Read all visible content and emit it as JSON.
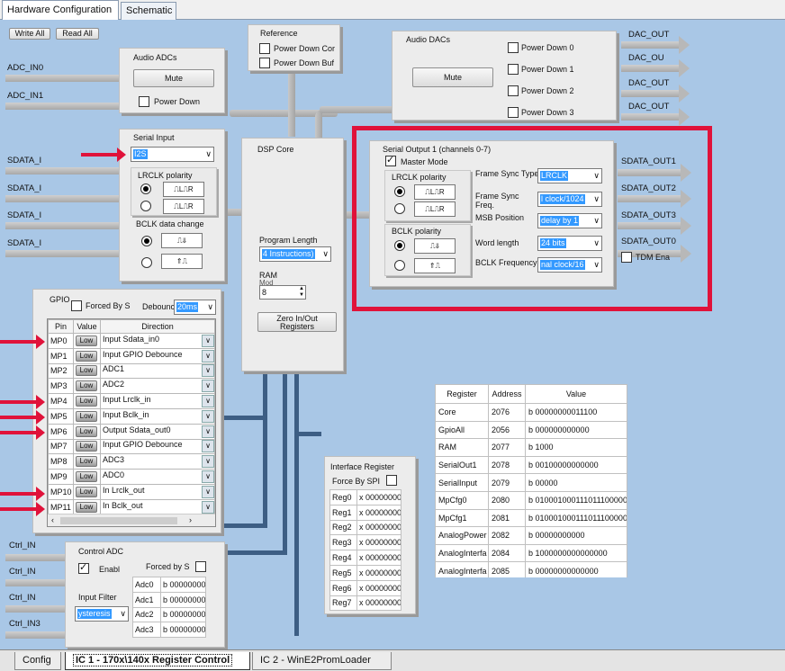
{
  "top_tabs": [
    "Hardware Configuration",
    "Schematic"
  ],
  "bottom_tabs": [
    "Config",
    "IC 1 - 170x\\140x Register Control",
    "IC 2 - WinE2PromLoader"
  ],
  "toolbar": {
    "write_all": "Write All",
    "read_all": "Read All"
  },
  "left_signals": [
    "ADC_IN0",
    "ADC_IN1",
    "SDATA_I",
    "SDATA_I",
    "SDATA_I",
    "SDATA_I"
  ],
  "ctrl_signals": [
    "Ctrl_IN",
    "Ctrl_IN",
    "Ctrl_IN",
    "Ctrl_IN3"
  ],
  "audio_adcs": {
    "title": "Audio ADCs",
    "mute": "Mute",
    "power_down": "Power Down"
  },
  "reference": {
    "title": "Reference",
    "power_down_cor": "Power Down Cor",
    "power_down_buf": "Power Down Buf"
  },
  "audio_dacs": {
    "title": "Audio DACs",
    "mute": "Mute",
    "power_down": [
      "Power Down 0",
      "Power Down 1",
      "Power Down 2",
      "Power Down 3"
    ]
  },
  "dac_outputs": [
    "DAC_OUT",
    "DAC_OU",
    "DAC_OUT",
    "DAC_OUT"
  ],
  "serial_input": {
    "title": "Serial Input",
    "format": "I2S",
    "lrclk_polarity": "LRCLK polarity",
    "bclk_data_change": "BCLK data change"
  },
  "dsp_core": {
    "title": "DSP Core",
    "program_length_label": "Program Length",
    "program_length_value": "4 Instructions)",
    "ram_label": "RAM",
    "ram_sub": "Mod",
    "ram_value": "8",
    "zero_button": "Zero In/Out Registers"
  },
  "serial_output": {
    "title": "Serial Output 1 (channels 0-7)",
    "master_mode": "Master Mode",
    "lrclk_polarity": "LRCLK polarity",
    "bclk_polarity": "BCLK polarity",
    "frame_sync_type_label": "Frame Sync Type",
    "frame_sync_type_value": "LRCLK",
    "frame_sync_freq_label": "Frame Sync Freq.",
    "frame_sync_freq_value": "l clock/1024",
    "msb_position_label": "MSB Position",
    "msb_position_value": "delay by 1",
    "word_length_label": "Word length",
    "word_length_value": "24 bits",
    "bclk_freq_label": "BCLK Frequency",
    "bclk_freq_value": "nal clock/16"
  },
  "sdata_outputs": [
    "SDATA_OUT1",
    "SDATA_OUT2",
    "SDATA_OUT3",
    "SDATA_OUT0"
  ],
  "tdm_ena": "TDM Ena",
  "gpio": {
    "title": "GPIO",
    "forced_by": "Forced By S",
    "debounce_label": "Debounc",
    "debounce_value": "20ms",
    "headers": [
      "Pin",
      "Value",
      "Direction"
    ],
    "rows": [
      {
        "pin": "MP0",
        "value": "Low",
        "dir": "Input  Sdata_in0"
      },
      {
        "pin": "MP1",
        "value": "Low",
        "dir": "Input  GPIO Debounce"
      },
      {
        "pin": "MP2",
        "value": "Low",
        "dir": "ADC1"
      },
      {
        "pin": "MP3",
        "value": "Low",
        "dir": "ADC2"
      },
      {
        "pin": "MP4",
        "value": "Low",
        "dir": "Input  Lrclk_in"
      },
      {
        "pin": "MP5",
        "value": "Low",
        "dir": "Input  Bclk_in"
      },
      {
        "pin": "MP6",
        "value": "Low",
        "dir": "Output Sdata_out0"
      },
      {
        "pin": "MP7",
        "value": "Low",
        "dir": "Input  GPIO Debounce"
      },
      {
        "pin": "MP8",
        "value": "Low",
        "dir": "ADC3"
      },
      {
        "pin": "MP9",
        "value": "Low",
        "dir": "ADC0"
      },
      {
        "pin": "MP10",
        "value": "Low",
        "dir": "In Lrclk_out"
      },
      {
        "pin": "MP11",
        "value": "Low",
        "dir": "In Bclk_out"
      }
    ]
  },
  "control_adc": {
    "title": "Control ADC",
    "enable": "Enabl",
    "forced_by": "Forced by S",
    "input_filter": "Input Filter",
    "filter_value": "ysteresis",
    "rows": [
      {
        "name": "Adc0",
        "val": "b 00000000"
      },
      {
        "name": "Adc1",
        "val": "b 00000000"
      },
      {
        "name": "Adc2",
        "val": "b 00000000"
      },
      {
        "name": "Adc3",
        "val": "b 00000000"
      }
    ]
  },
  "interface_register": {
    "title": "Interface Register",
    "force_by_spi": "Force By SPI",
    "rows": [
      {
        "name": "Reg0",
        "val": "x 00000000"
      },
      {
        "name": "Reg1",
        "val": "x 00000000"
      },
      {
        "name": "Reg2",
        "val": "x 00000000"
      },
      {
        "name": "Reg3",
        "val": "x 00000000"
      },
      {
        "name": "Reg4",
        "val": "x 00000000"
      },
      {
        "name": "Reg5",
        "val": "x 00000000"
      },
      {
        "name": "Reg6",
        "val": "x 00000000"
      },
      {
        "name": "Reg7",
        "val": "x 00000000"
      }
    ]
  },
  "register_table": {
    "headers": [
      "Register",
      "Address",
      "Value"
    ],
    "rows": [
      {
        "reg": "Core",
        "addr": "2076",
        "val": "b 00000000011100"
      },
      {
        "reg": "GpioAll",
        "addr": "2056",
        "val": "b 000000000000"
      },
      {
        "reg": "RAM",
        "addr": "2077",
        "val": "b 1000"
      },
      {
        "reg": "SerialOut1",
        "addr": "2078",
        "val": "b 00100000000000"
      },
      {
        "reg": "SerialInput",
        "addr": "2079",
        "val": "b 00000"
      },
      {
        "reg": "MpCfg0",
        "addr": "2080",
        "val": "b 010001000111011100000"
      },
      {
        "reg": "MpCfg1",
        "addr": "2081",
        "val": "b 010001000111011100000"
      },
      {
        "reg": "AnalogPower",
        "addr": "2082",
        "val": "b 00000000000"
      },
      {
        "reg": "AnalogInterfa",
        "addr": "2084",
        "val": "b 1000000000000000"
      },
      {
        "reg": "AnalogInterfa",
        "addr": "2085",
        "val": "b 00000000000000"
      }
    ]
  },
  "colors": {
    "canvas": "#a9c7e6",
    "highlight": "#e0123a",
    "selection": "#3399ff",
    "bus": "#3d5e84"
  }
}
